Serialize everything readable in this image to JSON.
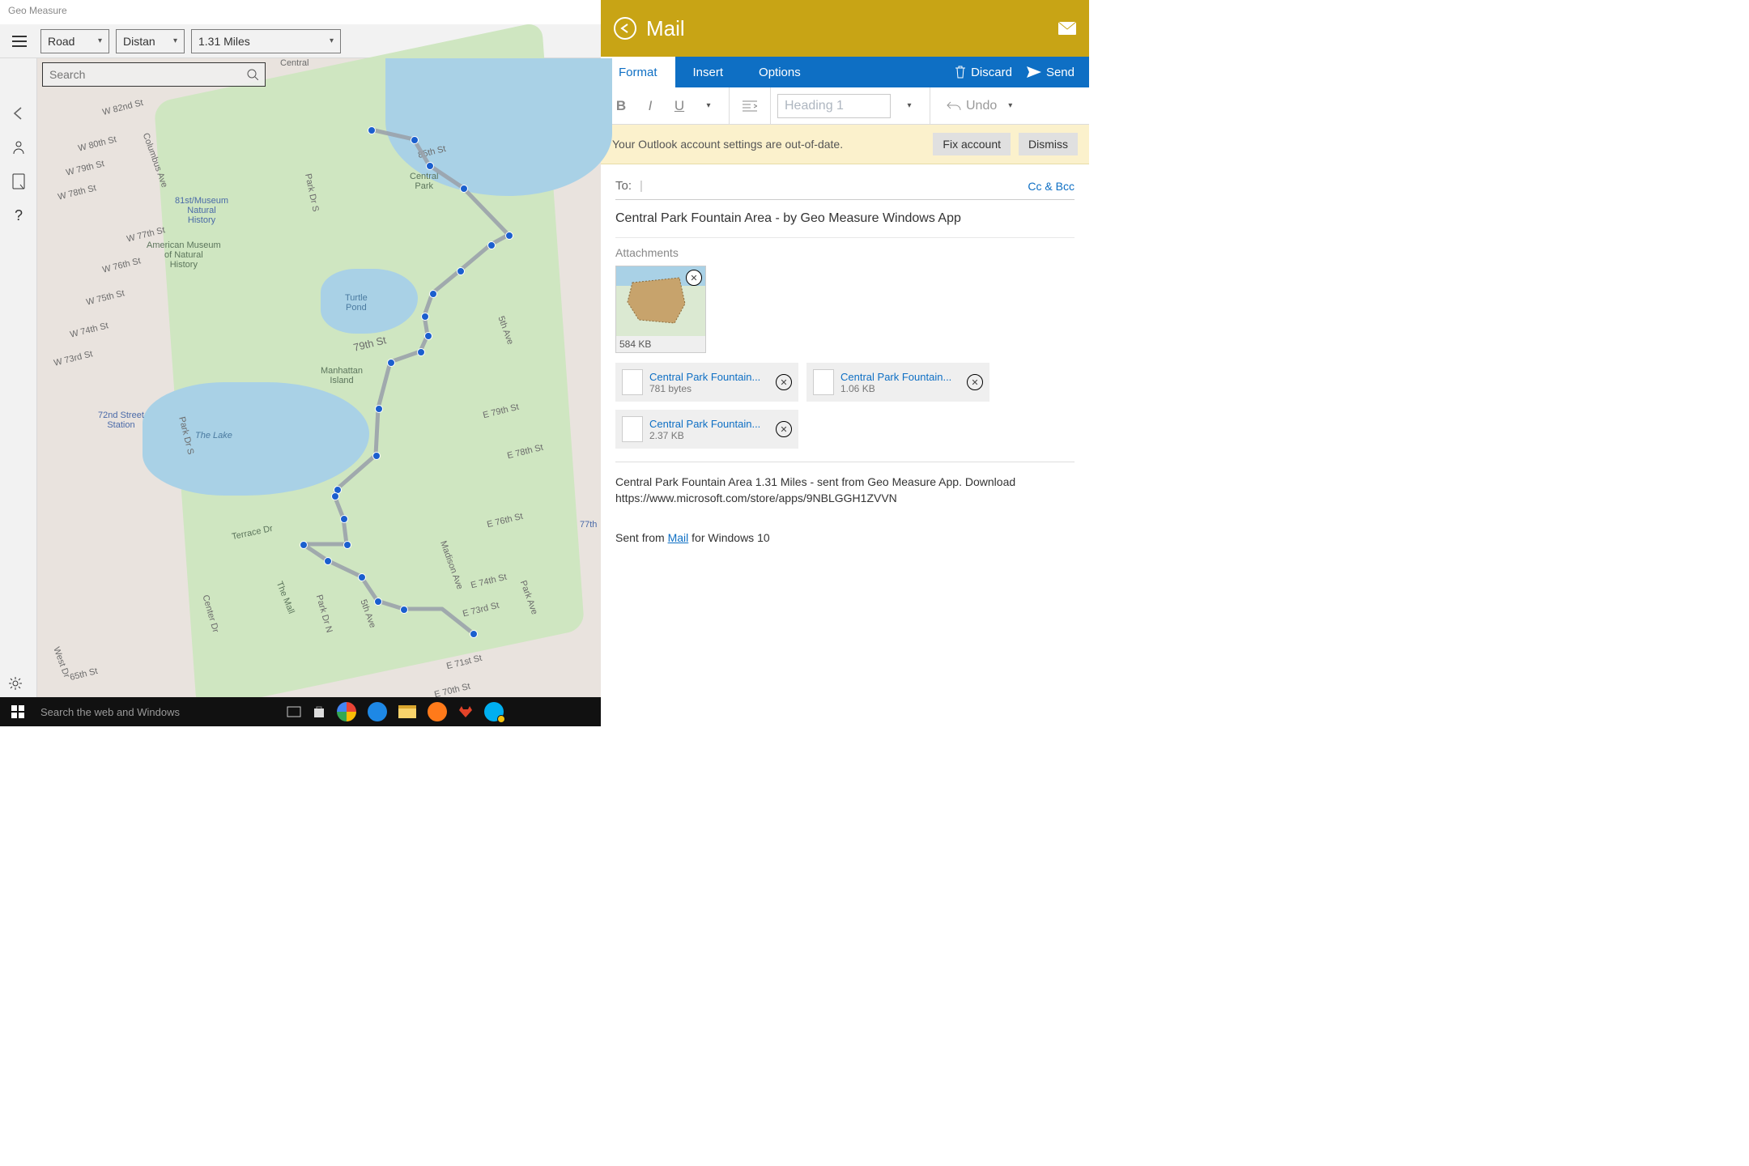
{
  "geo": {
    "title": "Geo Measure",
    "map_type": "Road",
    "measure_mode": "Distan",
    "measure_value": "1.31 Miles",
    "search_placeholder": "Search",
    "map": {
      "poi": {
        "central_park": "Central\nPark",
        "museum1": "81st/Museum\nNatural\nHistory",
        "museum2": "American Museum\nof Natural\nHistory",
        "turtle_pond": "Turtle\nPond",
        "manhattan_island": "Manhattan\nIsland",
        "the_lake": "The Lake",
        "station": "72nd Street\nStation",
        "terrace": "Terrace Dr",
        "the_mall": "The Mall",
        "seventyseven": "77th"
      },
      "streets": {
        "w82": "W 82nd St",
        "w80": "W 80th St",
        "w79": "W 79th St",
        "w78": "W 78th St",
        "w77": "W 77th St",
        "w76": "W 76th St",
        "w75": "W 75th St",
        "w74": "W 74th St",
        "w73": "W 73rd St",
        "columbus": "Columbus Ave",
        "parkdrs": "Park Dr S",
        "seventyninth": "79th St",
        "fifth": "5th Ave",
        "fifth2": "5th Ave",
        "parkdrn": "Park Dr N",
        "madison": "Madison Ave",
        "parkave": "Park Ave",
        "e79": "E 79th St",
        "e78": "E 78th St",
        "e76": "E 76th St",
        "e74": "E 74th St",
        "e73": "E 73rd St",
        "e71": "E 71st St",
        "e70": "E 70th St",
        "sixtyfive": "65th St",
        "westdr": "West Dr",
        "eightyfifth": "85th St",
        "centralline": "Central",
        "centerdr": "Center Dr"
      }
    }
  },
  "mail": {
    "app_title": "Mail",
    "tabs": {
      "format": "Format",
      "insert": "Insert",
      "options": "Options"
    },
    "actions": {
      "discard": "Discard",
      "send": "Send"
    },
    "toolbar": {
      "heading": "Heading 1",
      "undo": "Undo"
    },
    "warning": {
      "text": "Your Outlook account settings are out-of-date.",
      "fix": "Fix account",
      "dismiss": "Dismiss"
    },
    "compose": {
      "to_label": "To:",
      "ccbcc": "Cc & Bcc",
      "subject": "Central Park Fountain Area - by Geo Measure Windows App",
      "attachments_label": "Attachments",
      "thumb_size": "584 KB",
      "files": [
        {
          "name": "Central Park Fountain...",
          "size": "781 bytes"
        },
        {
          "name": "Central Park Fountain...",
          "size": "1.06 KB"
        },
        {
          "name": "Central Park Fountain...",
          "size": "2.37 KB"
        }
      ],
      "body_line1": "Central Park Fountain Area 1.31 Miles - sent from Geo Measure App. Download",
      "body_line2": "https://www.microsoft.com/store/apps/9NBLGGH1ZVVN",
      "sig_pre": "Sent from ",
      "sig_link": "Mail",
      "sig_post": " for Windows 10"
    }
  },
  "taskbar": {
    "search": "Search the web and Windows"
  }
}
